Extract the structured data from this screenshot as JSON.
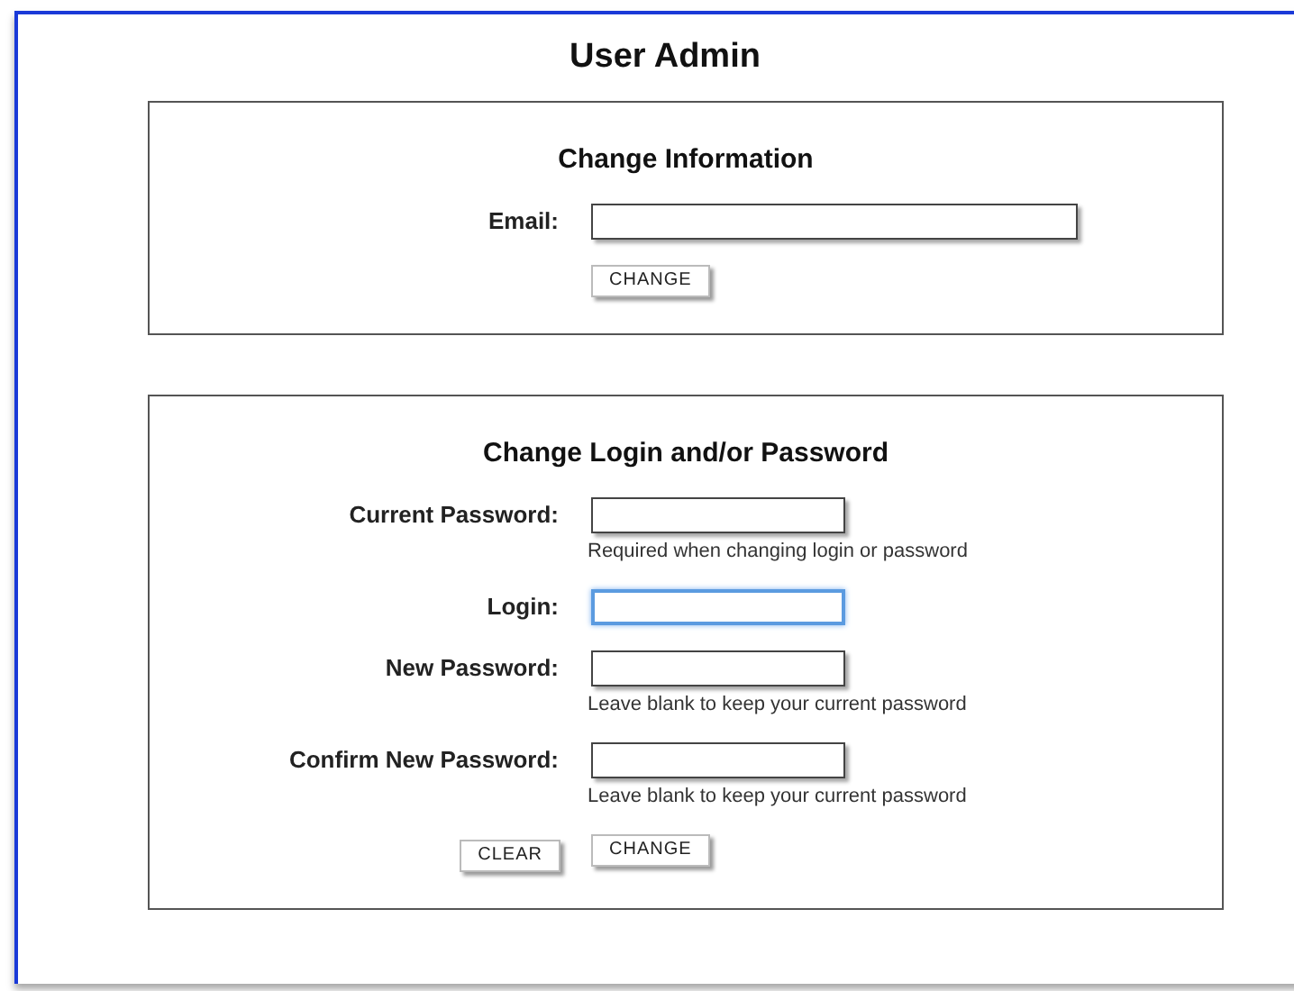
{
  "page": {
    "title": "User Admin"
  },
  "sections": [
    {
      "title": "Change Information",
      "fields": [
        {
          "label": "Email:",
          "kind": "wide",
          "focused": false
        }
      ],
      "buttons": [
        {
          "label": "CHANGE",
          "kind": "submit"
        }
      ]
    },
    {
      "title": "Change Login and/or Password",
      "fields": [
        {
          "label": "Current Password:",
          "kind": "short",
          "focused": false,
          "hint": "Required when changing login or password"
        },
        {
          "label": "Login:",
          "kind": "short",
          "focused": true
        },
        {
          "label": "New Password:",
          "kind": "short",
          "focused": false,
          "hint": "Leave blank to keep your current password"
        },
        {
          "label": "Confirm New Password:",
          "kind": "short",
          "focused": false,
          "hint": "Leave blank to keep your current password"
        }
      ],
      "buttons": [
        {
          "label": "CLEAR",
          "kind": "reset"
        },
        {
          "label": "CHANGE",
          "kind": "submit"
        }
      ]
    }
  ]
}
